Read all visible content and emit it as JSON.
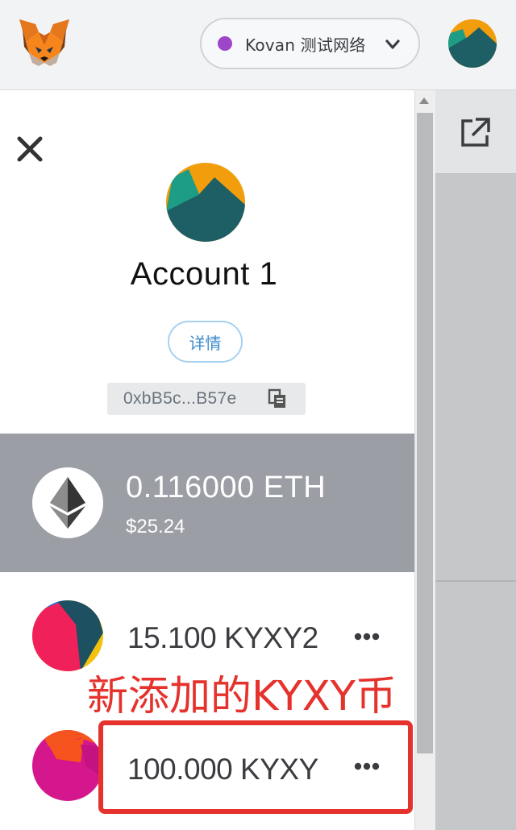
{
  "header": {
    "network_label": "Kovan 测试网络",
    "network_color": "#9d46c8"
  },
  "account": {
    "name": "Account 1",
    "details_label": "详情",
    "address": "0xbB5c...B57e"
  },
  "balance": {
    "amount": "0.116000 ETH",
    "fiat": "$25.24"
  },
  "tokens": [
    {
      "amount": "15.100",
      "symbol": "KYXY2"
    },
    {
      "amount": "100.000",
      "symbol": "KYXY"
    }
  ],
  "annotation": {
    "text": "新添加的KYXY币",
    "color": "#e5322c"
  },
  "icons": [
    "metamask-fox-icon",
    "chevron-down-icon",
    "external-link-icon",
    "close-icon",
    "copy-icon",
    "eth-icon",
    "more-icon",
    "scroll-up-arrow-icon"
  ]
}
